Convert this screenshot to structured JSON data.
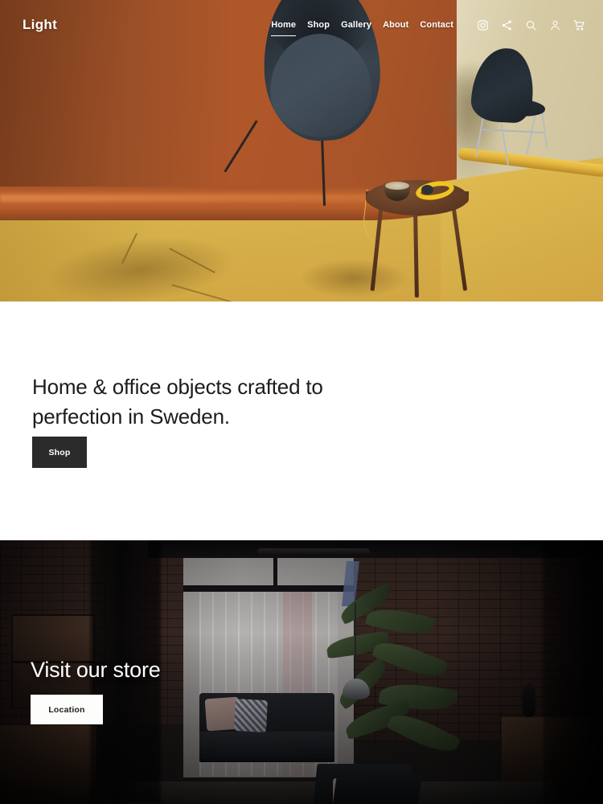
{
  "site": {
    "logo": "Light"
  },
  "nav": {
    "links": [
      {
        "label": "Home",
        "active": true
      },
      {
        "label": "Shop",
        "active": false
      },
      {
        "label": "Gallery",
        "active": false
      },
      {
        "label": "About",
        "active": false
      },
      {
        "label": "Contact",
        "active": false
      }
    ],
    "icons": [
      {
        "name": "instagram-icon",
        "label": "Instagram"
      },
      {
        "name": "share-icon",
        "label": "Share"
      },
      {
        "name": "search-icon",
        "label": "Search"
      },
      {
        "name": "user-account-icon",
        "label": "Account"
      },
      {
        "name": "shopping-cart-icon",
        "label": "Cart"
      }
    ]
  },
  "hero": {
    "alt": "Terracotta backdrop with yellow floor, hanging pod chair, dark side chair and wooden side table with bowl and yellow headphones",
    "colors": {
      "wall_rust": "#a8572b",
      "wall_cream": "#d5caa4",
      "floor_yellow": "#d4af4b",
      "chair_navy": "#2a333d",
      "table_wood": "#6a4128",
      "headphones_yellow": "#f0c322"
    }
  },
  "intro": {
    "heading": "Home & office objects crafted to perfection in Sweden.",
    "cta_label": "Shop",
    "cta_bg": "#2b2b2b",
    "cta_text_color": "#ffffff"
  },
  "store": {
    "heading": "Visit our store",
    "cta_label": "Location",
    "cta_bg": "#fdfdfb",
    "cta_text_color": "#23201f",
    "alt": "Dark loft interior with brick walls, large window with curtains, dark sofa with pillows and a tall plant"
  }
}
